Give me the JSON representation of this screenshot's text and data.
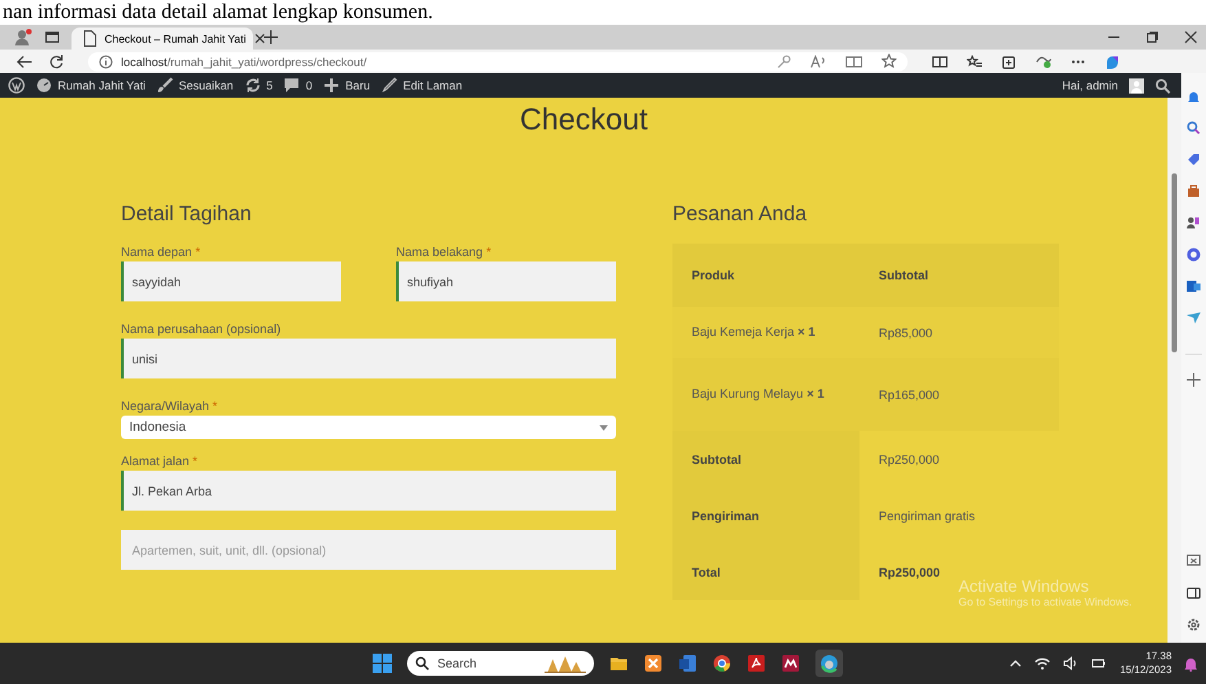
{
  "document_text": "nan informasi data detail alamat lengkap konsumen.",
  "browser": {
    "tabs": [
      {
        "title": "Checkout – Rumah Jahit Yati",
        "selected": true
      }
    ],
    "address": {
      "host": "localhost",
      "path": "/rumah_jahit_yati/wordpress/checkout/"
    }
  },
  "admin_bar": {
    "items": [
      {
        "kind": "site",
        "label": "Rumah Jahit Yati"
      },
      {
        "kind": "customize",
        "label": "Sesuaikan"
      },
      {
        "kind": "updates",
        "label": "5"
      },
      {
        "kind": "comments",
        "label": "0"
      },
      {
        "kind": "new",
        "label": "Baru"
      },
      {
        "kind": "edit",
        "label": "Edit Laman"
      }
    ],
    "greeting": "Hai, admin"
  },
  "page": {
    "title": "Checkout",
    "billing": {
      "heading": "Detail Tagihan",
      "rows": [
        [
          {
            "kind": "text",
            "label": "Nama depan",
            "required_mark": "*",
            "value": "sayyidah",
            "validated": true
          },
          {
            "kind": "text",
            "label": "Nama belakang",
            "required_mark": "*",
            "value": "shufiyah",
            "validated": true
          }
        ],
        [
          {
            "kind": "text",
            "label": "Nama perusahaan (opsional)",
            "value": "unisi",
            "validated": true
          }
        ],
        [
          {
            "kind": "select",
            "label": "Negara/Wilayah",
            "required_mark": "*",
            "value": "Indonesia"
          }
        ],
        [
          {
            "kind": "text",
            "label": "Alamat jalan",
            "required_mark": "*",
            "value": "Jl. Pekan Arba",
            "validated": true
          }
        ],
        [
          {
            "kind": "text",
            "placeholder": "Apartemen, suit, unit, dll. (opsional)",
            "validated": false
          }
        ]
      ]
    },
    "order": {
      "heading": "Pesanan Anda",
      "columns": [
        "Produk",
        "Subtotal"
      ],
      "items": [
        {
          "product": "Baju Kemeja Kerja",
          "quantity": "× 1",
          "subtotal": "Rp85,000"
        },
        {
          "product": "Baju Kurung Melayu",
          "quantity": "× 1",
          "subtotal": "Rp165,000"
        }
      ],
      "totals": [
        {
          "label": "Subtotal",
          "value": "Rp250,000",
          "emphasis": false
        },
        {
          "label": "Pengiriman",
          "value": "Pengiriman gratis",
          "emphasis": false
        },
        {
          "label": "Total",
          "value": "Rp250,000",
          "emphasis": true
        }
      ]
    }
  },
  "activation_notice": {
    "title": "Activate Windows",
    "subtitle": "Go to Settings to activate Windows."
  },
  "taskbar": {
    "search_placeholder": "Search",
    "time": "17.38",
    "date": "15/12/2023"
  }
}
